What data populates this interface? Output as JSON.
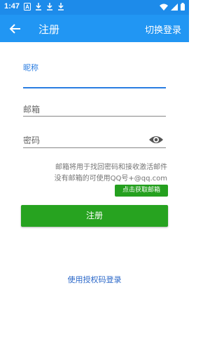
{
  "status_bar": {
    "time": "1:47",
    "notification_icons": [
      "a-box-icon",
      "download-icon",
      "download-icon",
      "download-icon"
    ]
  },
  "app_bar": {
    "title": "注册",
    "action": "切换登录"
  },
  "form": {
    "nickname_label": "昵称",
    "email_label": "邮箱",
    "password_label": "密码"
  },
  "hint": {
    "line1": "邮箱将用于找回密码和接收激活邮件",
    "line2": "没有邮箱的可使用QQ号+@qq.com"
  },
  "buttons": {
    "get_email": "点击获取邮箱",
    "register": "注册",
    "auth_code_login": "使用授权码登录"
  },
  "colors": {
    "accent": "#2196f3",
    "button": "#27a320",
    "link": "#2a67c8"
  }
}
